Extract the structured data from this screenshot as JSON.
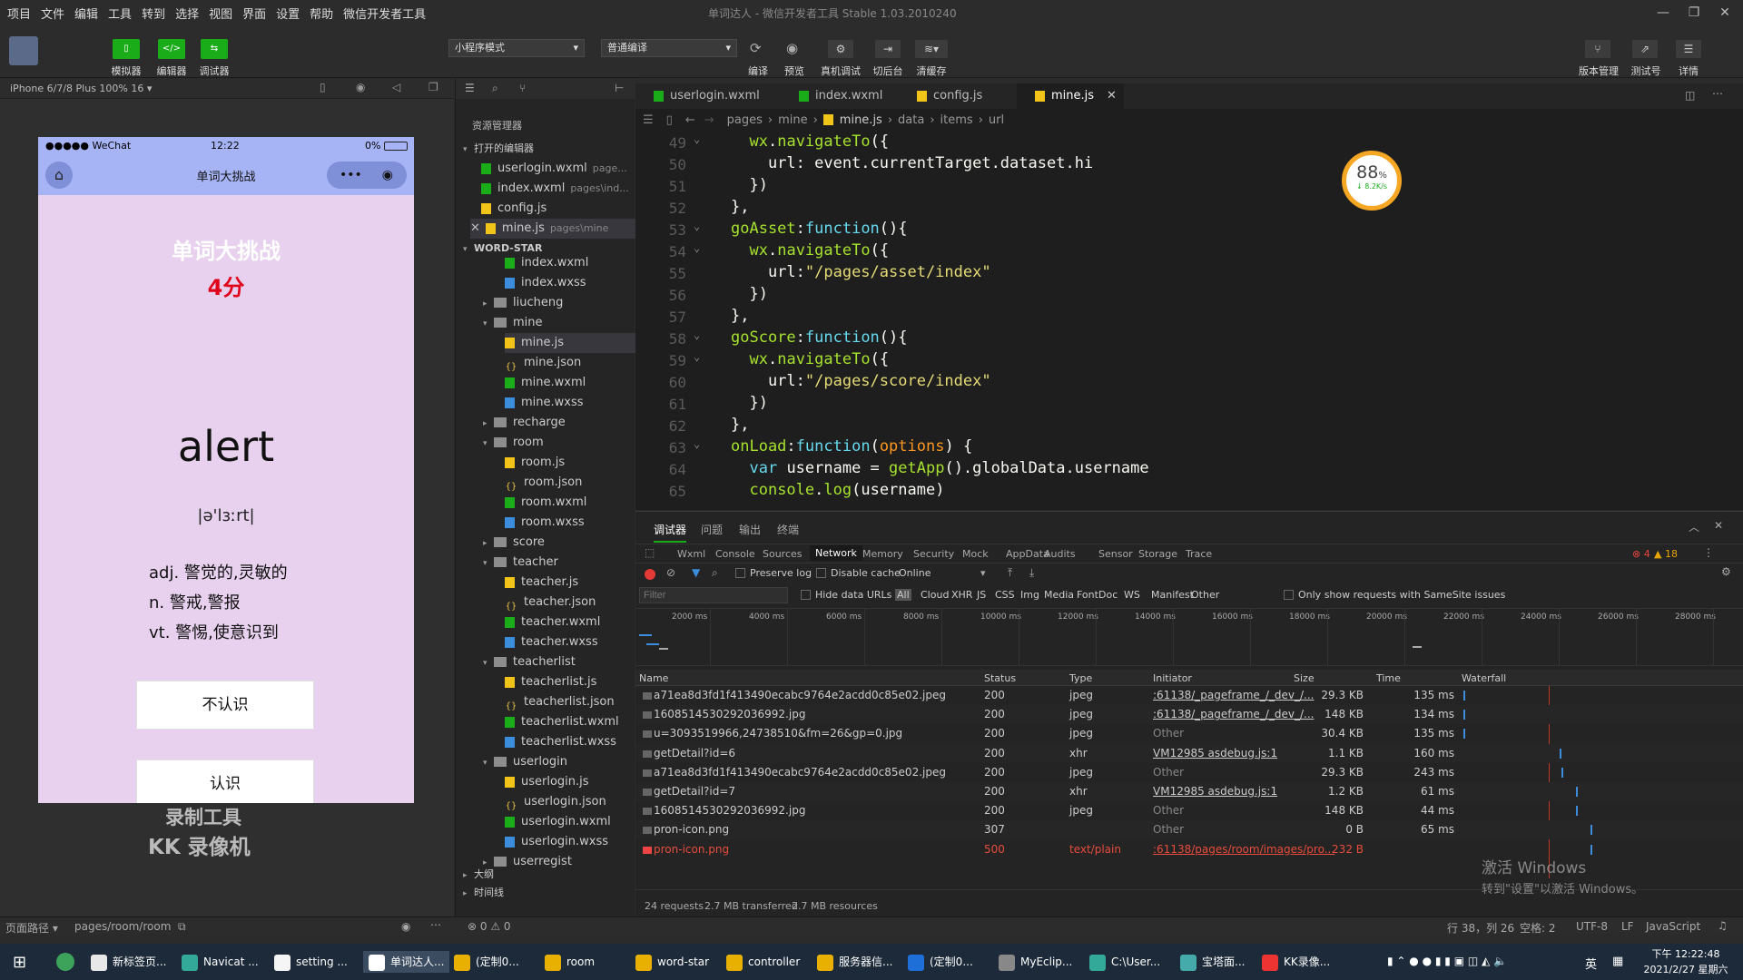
{
  "menubar": {
    "items": [
      "项目",
      "文件",
      "编辑",
      "工具",
      "转到",
      "选择",
      "视图",
      "界面",
      "设置",
      "帮助",
      "微信开发者工具"
    ]
  },
  "window": {
    "title": "单词达人 - 微信开发者工具 Stable 1.03.2010240"
  },
  "toolbar": {
    "left_buttons": [
      {
        "label": "模拟器",
        "icon": "phone-icon"
      },
      {
        "label": "编辑器",
        "icon": "code-icon"
      },
      {
        "label": "调试器",
        "icon": "debug-icon"
      }
    ],
    "mode_select": "小程序模式",
    "compile_select": "普通编译",
    "actions": [
      "编译",
      "预览",
      "真机调试",
      "切后台",
      "清缓存"
    ],
    "right_buttons": [
      "版本管理",
      "测试号",
      "详情"
    ]
  },
  "simulator": {
    "device": "iPhone 6/7/8 Plus 100% 16 ▾",
    "status_left": "●●●●● WeChat",
    "time": "12:22",
    "battery": "0%",
    "nav_title": "单词大挑战",
    "page_title": "单词大挑战",
    "score": "4分",
    "word": "alert",
    "phonetic": "|ə'lɜːrt|",
    "meanings": [
      "adj. 警觉的,灵敏的",
      "n. 警戒,警报",
      "vt. 警惕,使意识到"
    ],
    "btn_unknown": "不认识",
    "btn_known": "认识",
    "watermark1": "录制工具",
    "watermark2": "KK 录像机"
  },
  "explorer": {
    "title": "资源管理器",
    "open_section": "打开的编辑器",
    "open_files": [
      {
        "name": "userlogin.wxml",
        "path": "page..."
      },
      {
        "name": "index.wxml",
        "path": "pages\\ind..."
      },
      {
        "name": "config.js",
        "path": ""
      },
      {
        "name": "mine.js",
        "path": "pages\\mine"
      }
    ],
    "project": "WORD-STAR",
    "tree": [
      "index.wxml",
      "index.wxss",
      "liucheng",
      "mine",
      "mine.js",
      "mine.json",
      "mine.wxml",
      "mine.wxss",
      "recharge",
      "room",
      "room.js",
      "room.json",
      "room.wxml",
      "room.wxss",
      "score",
      "teacher",
      "teacher.js",
      "teacher.json",
      "teacher.wxml",
      "teacher.wxss",
      "teacherlist",
      "teacherlist.js",
      "teacherlist.json",
      "teacherlist.wxml",
      "teacherlist.wxss",
      "userlogin",
      "userlogin.js",
      "userlogin.json",
      "userlogin.wxml",
      "userlogin.wxss",
      "userregist"
    ],
    "outline": "大纲",
    "timeline": "时间线"
  },
  "editor": {
    "tabs": [
      "userlogin.wxml",
      "index.wxml",
      "config.js",
      "mine.js"
    ],
    "breadcrumb": [
      "pages",
      "mine",
      "mine.js",
      "data",
      "items",
      "url"
    ],
    "line_numbers": [
      "49",
      "50",
      "51",
      "52",
      "53",
      "54",
      "55",
      "56",
      "57",
      "58",
      "59",
      "60",
      "61",
      "62",
      "63",
      "64",
      "65"
    ],
    "perf_value": "88",
    "perf_unit": "%",
    "perf_speed": "↓ 8.2K/s"
  },
  "devtools": {
    "top_tabs": [
      "调试器",
      "问题",
      "输出",
      "终端"
    ],
    "panels": [
      "Wxml",
      "Console",
      "Sources",
      "Network",
      "Memory",
      "Security",
      "Mock",
      "AppData",
      "Audits",
      "Sensor",
      "Storage",
      "Trace"
    ],
    "errors": "4",
    "warnings": "18",
    "preserve_log": "Preserve log",
    "disable_cache": "Disable cache",
    "online": "Online",
    "filter_placeholder": "Filter",
    "hide_data_urls": "Hide data URLs",
    "filter_types": [
      "All",
      "Cloud",
      "XHR",
      "JS",
      "CSS",
      "Img",
      "Media",
      "Font",
      "Doc",
      "WS",
      "Manifest",
      "Other"
    ],
    "samesite": "Only show requests with SameSite issues",
    "timeline_ticks": [
      "2000 ms",
      "4000 ms",
      "6000 ms",
      "8000 ms",
      "10000 ms",
      "12000 ms",
      "14000 ms",
      "16000 ms",
      "18000 ms",
      "20000 ms",
      "22000 ms",
      "24000 ms",
      "26000 ms",
      "28000 ms"
    ],
    "columns": [
      "Name",
      "Status",
      "Type",
      "Initiator",
      "Size",
      "Time",
      "Waterfall"
    ],
    "rows": [
      {
        "name": "a71ea8d3fd1f413490ecabc9764e2acdd0c85e02.jpeg",
        "status": "200",
        "type": "jpeg",
        "initiator": ":61138/_pageframe_/_dev_/...",
        "size": "29.3 KB",
        "time": "135 ms",
        "link": true
      },
      {
        "name": "1608514530292036992.jpg",
        "status": "200",
        "type": "jpeg",
        "initiator": ":61138/_pageframe_/_dev_/...",
        "size": "148 KB",
        "time": "134 ms",
        "link": true
      },
      {
        "name": "u=3093519966,24738510&fm=26&gp=0.jpg",
        "status": "200",
        "type": "jpeg",
        "initiator": "Other",
        "size": "30.4 KB",
        "time": "135 ms",
        "link": false
      },
      {
        "name": "getDetail?id=6",
        "status": "200",
        "type": "xhr",
        "initiator": "VM12985 asdebug.js:1",
        "size": "1.1 KB",
        "time": "160 ms",
        "link": true
      },
      {
        "name": "a71ea8d3fd1f413490ecabc9764e2acdd0c85e02.jpeg",
        "status": "200",
        "type": "jpeg",
        "initiator": "Other",
        "size": "29.3 KB",
        "time": "243 ms",
        "link": false
      },
      {
        "name": "getDetail?id=7",
        "status": "200",
        "type": "xhr",
        "initiator": "VM12985 asdebug.js:1",
        "size": "1.2 KB",
        "time": "61 ms",
        "link": true
      },
      {
        "name": "1608514530292036992.jpg",
        "status": "200",
        "type": "jpeg",
        "initiator": "Other",
        "size": "148 KB",
        "time": "44 ms",
        "link": false
      },
      {
        "name": "pron-icon.png",
        "status": "307",
        "type": "",
        "initiator": "Other",
        "size": "0 B",
        "time": "65 ms",
        "link": false
      },
      {
        "name": "pron-icon.png",
        "status": "500",
        "type": "text/plain",
        "initiator": ":61138/pages/room/images/pro...",
        "size": "232 B",
        "time": "",
        "link": true,
        "error": true
      }
    ],
    "summary": [
      "24 requests",
      "2.7 MB transferred",
      "2.7 MB resources"
    ],
    "activate1": "激活 Windows",
    "activate2": "转到\"设置\"以激活 Windows。"
  },
  "status": {
    "path_label": "页面路径 ▾",
    "path": "pages/room/room",
    "errors": "⊗ 0 ⚠ 0",
    "pos": "行 38，列 26",
    "spaces": "空格: 2",
    "enc": "UTF-8",
    "eol": "LF",
    "lang": "JavaScript"
  },
  "taskbar": {
    "apps": [
      "新标签页...",
      "Navicat ...",
      "setting ...",
      "单词达人...",
      "(定制0...",
      "room",
      "word-star",
      "controller",
      "服务器信...",
      "(定制0...",
      "MyEclip...",
      "C:\\User...",
      "宝塔面...",
      "KK录像..."
    ],
    "time": "下午 12:22:48",
    "date": "2021/2/27 星期六",
    "ime": "英"
  }
}
